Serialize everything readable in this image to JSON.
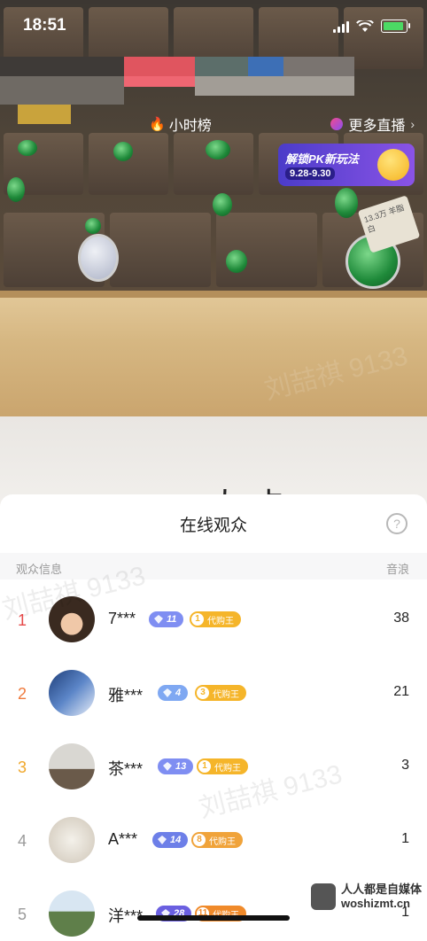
{
  "status_bar": {
    "time": "18:51"
  },
  "overlay": {
    "hour_rank_label": "小时榜",
    "more_live_label": "更多直播",
    "pk_banner": {
      "title": "解锁PK新玩法",
      "dates": "9.28-9.30"
    }
  },
  "scene": {
    "floor_text": "人 卡",
    "tag_text": "13.3万 羊脂白"
  },
  "sheet": {
    "title": "在线观众",
    "col_left": "观众信息",
    "col_right": "音浪",
    "viewers": [
      {
        "rank": "1",
        "name": "7***",
        "level": "11",
        "badge_num": "1",
        "badge_text": "代购王",
        "score": "38"
      },
      {
        "rank": "2",
        "name": "雅***",
        "level": "4",
        "badge_num": "3",
        "badge_text": "代购王",
        "score": "21"
      },
      {
        "rank": "3",
        "name": "茶***",
        "level": "13",
        "badge_num": "1",
        "badge_text": "代购王",
        "score": "3"
      },
      {
        "rank": "4",
        "name": "A***",
        "level": "14",
        "badge_num": "8",
        "badge_text": "代购王",
        "score": "1"
      },
      {
        "rank": "5",
        "name": "洋***",
        "level": "28",
        "badge_num": "11",
        "badge_text": "代购王",
        "score": "1"
      }
    ]
  },
  "watermarks": {
    "author": "刘喆祺 9133"
  },
  "site": {
    "line1": "人人都是自媒体",
    "line2": "woshizmt.cn"
  },
  "colors": {
    "rank1": "#e64a4a",
    "rank2": "#ef7a3d",
    "rank3": "#f0a72a",
    "rank_other": "#9a9a9a",
    "level_blue": "#7a8cf0",
    "badge_gold": "#f5b52a"
  }
}
